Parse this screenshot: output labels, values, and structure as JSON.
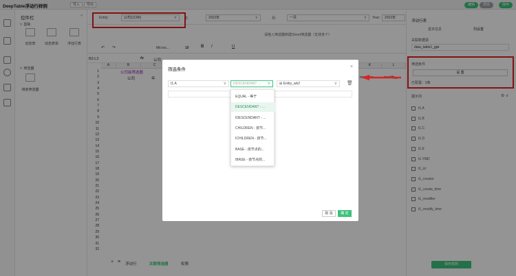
{
  "titlebar": {
    "title": "DeepTable浮动行样例",
    "import": "导入",
    "export": "导出",
    "pills": [
      "编辑",
      "预览",
      "保存"
    ]
  },
  "controls": {
    "title": "控件栏",
    "section_basic": "基础",
    "basic_items": [
      "动态表",
      "动态表单",
      "浮动行表"
    ],
    "section_filter": "筛选器",
    "filter_items": [
      "维度筛选器"
    ]
  },
  "filterbar": {
    "entity_label": "Entity:",
    "entity_value": "公司1(CMI)",
    "year_label": "年:",
    "year_value": "2022年",
    "month_label": "月:",
    "month_value": "一月",
    "yr_label": "Year:",
    "yr_value": "2022年"
  },
  "hint": "请拖入筛选器到建Sheet筛选器（支持多个）",
  "toolbar": {
    "font": "Micros...",
    "size": "10",
    "items": [
      "B",
      "I",
      "U"
    ]
  },
  "formula": {
    "cell": "B2:L2",
    "value": "公司"
  },
  "sheet": {
    "columns": [
      "A",
      "B",
      "C",
      "K",
      "L"
    ],
    "header_cell": "公司级筛选器",
    "row2_cells": [
      "公司",
      "年"
    ],
    "right_headers": [
      "modifier",
      "modify_..."
    ],
    "rows": [
      "1",
      "2",
      "3",
      "4",
      "5",
      "6",
      "7",
      "8",
      "9",
      "10",
      "11",
      "12",
      "13",
      "14",
      "15",
      "16",
      "17",
      "18",
      "19",
      "20",
      "21",
      "22",
      "23",
      "24",
      "25",
      "26",
      "27",
      "28",
      "29",
      "30",
      "31",
      "32"
    ]
  },
  "sheettabs": {
    "add": "+",
    "menu": "≡",
    "tabs": [
      "浮动行",
      "关联筛选器",
      "权限"
    ]
  },
  "dialog": {
    "title": "筛选条件",
    "field": "t1.A",
    "operator_placeholder": "DESCENDANT ...",
    "value": "Entity_wb2",
    "options": [
      "EQUAL - 等于",
      "DESCENDANT - ...",
      "IDESCENDANT - ...",
      "CHILDREN - 孩节...",
      "ICHILDREN - 孩节...",
      "BASE - 孩节点的...",
      "IBASE - 孩节点的..."
    ],
    "selected_index": 1,
    "cancel": "取 消",
    "confirm": "确 定"
  },
  "rightpanel": {
    "title": "浮动行表",
    "tabs": [
      "基本信息",
      "列设置"
    ],
    "data_source_label": "关联数据源",
    "data_source_value": "data_table1_gjw",
    "filter_section_label": "筛选条件",
    "filter_set_button": "设 置",
    "filter_count": "已配置：0条",
    "display_label": "展示列",
    "fields": [
      "t1.A",
      "t1.B",
      "t1.C",
      "t1.D",
      "t1.E",
      "t1.YMD",
      "t1_id",
      "t1_creator",
      "t1_create_time",
      "t1_modifier",
      "t1_modify_time"
    ],
    "save_button": "保存规则"
  },
  "colors": {
    "accent": "#3ec27c",
    "highlight": "#e02020",
    "overlay": "rgba(0,0,0,0.42)"
  }
}
